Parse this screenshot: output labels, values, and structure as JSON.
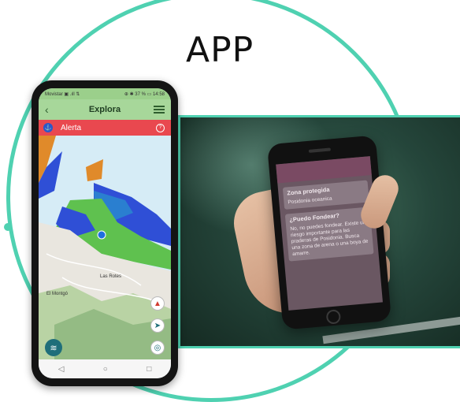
{
  "heading": "APP",
  "phone": {
    "status_left": "Movistar ▣ .ıll ⇅",
    "status_right": "⊕ ✱ 37 % ▭ 14:58",
    "app_title": "Explora",
    "alert_label": "Alerta",
    "map_labels": [
      "Las Rotes",
      "El Montgó"
    ],
    "nav": [
      "◁",
      "○",
      "□"
    ]
  },
  "photo_phone": {
    "card1_title": "Zona protegida",
    "card1_text": "Posidonia oceanica",
    "card2_title": "¿Puedo Fondear?",
    "card2_text": "No, no puedes fondear. Existe un riesgo importante para las praderas de Posidonia. Busca una zona de arena o una boya de amarre."
  },
  "colors": {
    "accent": "#4fd1b1",
    "alert": "#e9484f",
    "appbar": "#a7d79a"
  }
}
